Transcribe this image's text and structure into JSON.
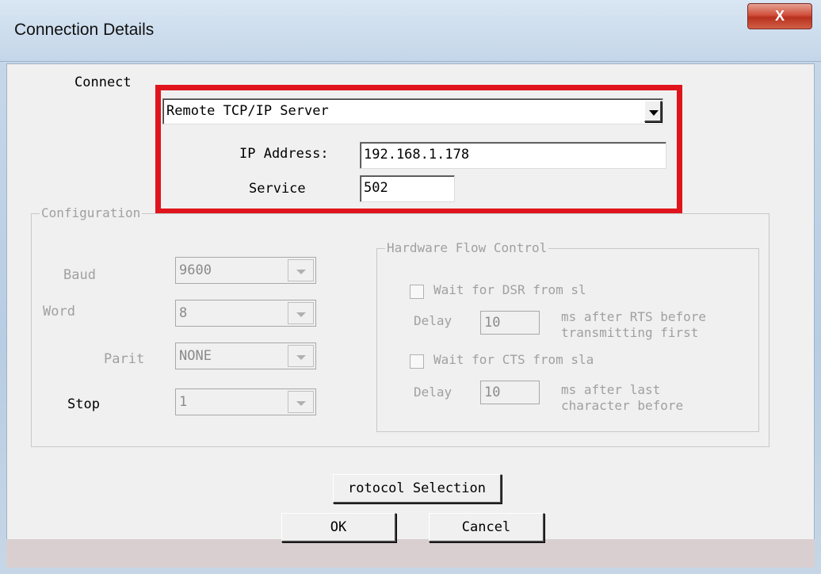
{
  "window": {
    "title": "Connection Details",
    "close_label": "X"
  },
  "connect": {
    "label": "Connect",
    "selected": "Remote TCP/IP Server",
    "ip_label": "IP Address:",
    "ip_value": "192.168.1.178",
    "service_label": "Service",
    "service_value": "502"
  },
  "configuration": {
    "title": "Configuration",
    "baud_label": "Baud",
    "baud_value": "9600",
    "word_label": "Word",
    "word_value": "8",
    "parity_label": "Parit",
    "parity_value": "NONE",
    "stop_label": "Stop",
    "stop_value": "1"
  },
  "flow_control": {
    "title": "Hardware Flow Control",
    "dsr_label": "Wait for DSR from sl",
    "delay_label": "Delay",
    "delay1_value": "10",
    "delay1_text_line1": "ms after RTS before",
    "delay1_text_line2": "transmitting first",
    "cts_label": "Wait for CTS from sla",
    "delay2_value": "10",
    "delay2_text_line1": "ms after last",
    "delay2_text_line2": "character before"
  },
  "buttons": {
    "protocol": "rotocol Selection",
    "ok": "OK",
    "cancel": "Cancel"
  },
  "colors": {
    "highlight": "#e0141c",
    "disabled_text": "#a0a0a0",
    "dialog_bg": "#f0f0f0"
  }
}
